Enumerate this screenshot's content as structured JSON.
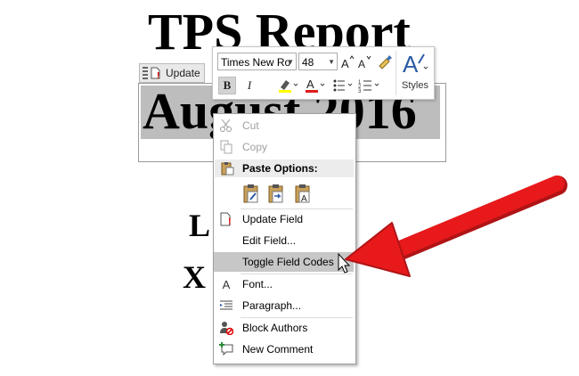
{
  "document": {
    "title": "TPS Report",
    "date": "August 2016",
    "line1": "L               han",
    "line2": "X                  any"
  },
  "field_tab": {
    "label": "Update"
  },
  "mini_toolbar": {
    "font_name": "Times New Ro",
    "font_size": "48",
    "bold": "B",
    "styles_label": "Styles"
  },
  "context_menu": {
    "items": [
      {
        "label": "Cut",
        "icon": "scissors-icon",
        "disabled": true
      },
      {
        "label": "Copy",
        "icon": "copy-icon",
        "disabled": true
      },
      {
        "label": "Paste Options:",
        "icon": "paste-icon"
      },
      {
        "label": "Update Field",
        "icon": "update-field-icon"
      },
      {
        "label": "Edit Field...",
        "icon": ""
      },
      {
        "label": "Toggle Field Codes",
        "icon": "",
        "highlighted": true
      },
      {
        "label": "Font...",
        "icon": "font-icon"
      },
      {
        "label": "Paragraph...",
        "icon": "paragraph-icon"
      },
      {
        "label": "Block Authors",
        "icon": "block-authors-icon"
      },
      {
        "label": "New Comment",
        "icon": "new-comment-icon"
      }
    ]
  },
  "colors": {
    "arrow": "#e8191b",
    "highlight": "#bdbdbd",
    "menu_hover": "#c7c7c7"
  }
}
